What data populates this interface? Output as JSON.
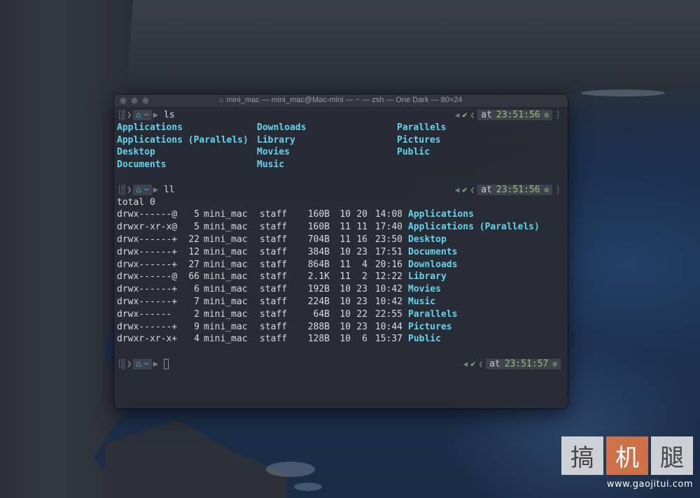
{
  "window": {
    "title": "mini_mac — mini_mac@Mac-mini — ~ — zsh — One Dark — 80×24"
  },
  "prompt": {
    "dir": "~",
    "at": "at"
  },
  "blocks": [
    {
      "command": "ls",
      "time": "23:51:56",
      "ls_columns": [
        [
          "Applications",
          "Applications (Parallels)",
          "Desktop",
          "Documents"
        ],
        [
          "Downloads",
          "Library",
          "Movies",
          "Music"
        ],
        [
          "Parallels",
          "Pictures",
          "Public"
        ]
      ]
    },
    {
      "command": "ll",
      "time": "23:51:56",
      "total": "total 0",
      "rows": [
        {
          "perm": "drwx------@",
          "links": "5",
          "user": "mini_mac",
          "group": "staff",
          "size": "160B",
          "mon": "10",
          "day": "20",
          "time": "14:08",
          "name": "Applications"
        },
        {
          "perm": "drwxr-xr-x@",
          "links": "5",
          "user": "mini_mac",
          "group": "staff",
          "size": "160B",
          "mon": "11",
          "day": "11",
          "time": "17:40",
          "name": "Applications (Parallels)"
        },
        {
          "perm": "drwx------+",
          "links": "22",
          "user": "mini_mac",
          "group": "staff",
          "size": "704B",
          "mon": "11",
          "day": "16",
          "time": "23:50",
          "name": "Desktop"
        },
        {
          "perm": "drwx------+",
          "links": "12",
          "user": "mini_mac",
          "group": "staff",
          "size": "384B",
          "mon": "10",
          "day": "23",
          "time": "17:51",
          "name": "Documents"
        },
        {
          "perm": "drwx------+",
          "links": "27",
          "user": "mini_mac",
          "group": "staff",
          "size": "864B",
          "mon": "11",
          "day": "4",
          "time": "20:16",
          "name": "Downloads"
        },
        {
          "perm": "drwx------@",
          "links": "66",
          "user": "mini_mac",
          "group": "staff",
          "size": "2.1K",
          "mon": "11",
          "day": "2",
          "time": "12:22",
          "name": "Library"
        },
        {
          "perm": "drwx------+",
          "links": "6",
          "user": "mini_mac",
          "group": "staff",
          "size": "192B",
          "mon": "10",
          "day": "23",
          "time": "10:42",
          "name": "Movies"
        },
        {
          "perm": "drwx------+",
          "links": "7",
          "user": "mini_mac",
          "group": "staff",
          "size": "224B",
          "mon": "10",
          "day": "23",
          "time": "10:42",
          "name": "Music"
        },
        {
          "perm": "drwx------",
          "links": "2",
          "user": "mini_mac",
          "group": "staff",
          "size": "64B",
          "mon": "10",
          "day": "22",
          "time": "22:55",
          "name": "Parallels"
        },
        {
          "perm": "drwx------+",
          "links": "9",
          "user": "mini_mac",
          "group": "staff",
          "size": "288B",
          "mon": "10",
          "day": "23",
          "time": "10:44",
          "name": "Pictures"
        },
        {
          "perm": "drwxr-xr-x+",
          "links": "4",
          "user": "mini_mac",
          "group": "staff",
          "size": "128B",
          "mon": "10",
          "day": "6",
          "time": "15:37",
          "name": "Public"
        }
      ]
    },
    {
      "command": "",
      "time": "23:51:57"
    }
  ],
  "icons": {
    "apple": "apple-icon",
    "home": "home-icon",
    "check": "check-icon",
    "clock": "clock-icon"
  },
  "colors": {
    "directory": "#61d5ee",
    "success": "#98c379",
    "dir_segment": "#38b6e8"
  },
  "watermark": {
    "chars": [
      "搞",
      "机",
      "腿"
    ],
    "url": "www.gaojitui.com"
  }
}
